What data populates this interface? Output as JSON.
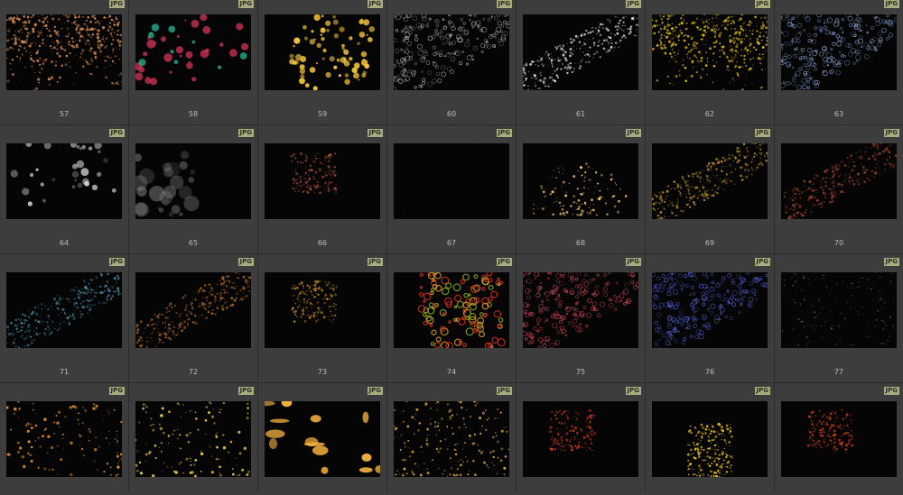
{
  "badge_label": "JPG",
  "thumbnails": [
    {
      "number": "57",
      "color": "#d48a52",
      "style": "dense"
    },
    {
      "number": "58",
      "color": "#e0385c",
      "style": "bokeh-mixed"
    },
    {
      "number": "59",
      "color": "#f2c23a",
      "style": "bokeh"
    },
    {
      "number": "60",
      "color": "#bdbdbd",
      "style": "rings"
    },
    {
      "number": "61",
      "color": "#e8e8e8",
      "style": "diagonal"
    },
    {
      "number": "62",
      "color": "#d6b21f",
      "style": "dense"
    },
    {
      "number": "63",
      "color": "#8fb0e6",
      "style": "rings"
    },
    {
      "number": "64",
      "color": "#d8d8d8",
      "style": "hex"
    },
    {
      "number": "65",
      "color": "#9a9a9a",
      "style": "blur"
    },
    {
      "number": "66",
      "color": "#b8513a",
      "style": "cluster"
    },
    {
      "number": "67",
      "color": "#2a1a12",
      "style": "faint"
    },
    {
      "number": "68",
      "color": "#f0c070",
      "style": "burst"
    },
    {
      "number": "69",
      "color": "#c8962e",
      "style": "diagonal"
    },
    {
      "number": "70",
      "color": "#a0442c",
      "style": "diagonal"
    },
    {
      "number": "71",
      "color": "#4a8aa8",
      "style": "diagonal"
    },
    {
      "number": "72",
      "color": "#b06a2c",
      "style": "diagonal"
    },
    {
      "number": "73",
      "color": "#c88a2a",
      "style": "cluster"
    },
    {
      "number": "74",
      "color": "#e0a02a",
      "style": "warm-bokeh"
    },
    {
      "number": "75",
      "color": "#e05060",
      "style": "rings"
    },
    {
      "number": "76",
      "color": "#5a6ae8",
      "style": "rings"
    },
    {
      "number": "77",
      "color": "#8a8a8a",
      "style": "faint-dots"
    },
    {
      "number": "",
      "color": "#e09030",
      "style": "sparse"
    },
    {
      "number": "",
      "color": "#f0c850",
      "style": "sparse"
    },
    {
      "number": "",
      "color": "#f2b040",
      "style": "big-bokeh"
    },
    {
      "number": "",
      "color": "#d8a040",
      "style": "grid-dots"
    },
    {
      "number": "",
      "color": "#d04020",
      "style": "cluster"
    },
    {
      "number": "",
      "color": "#e8c020",
      "style": "fountain"
    },
    {
      "number": "",
      "color": "#d04020",
      "style": "cluster"
    }
  ]
}
